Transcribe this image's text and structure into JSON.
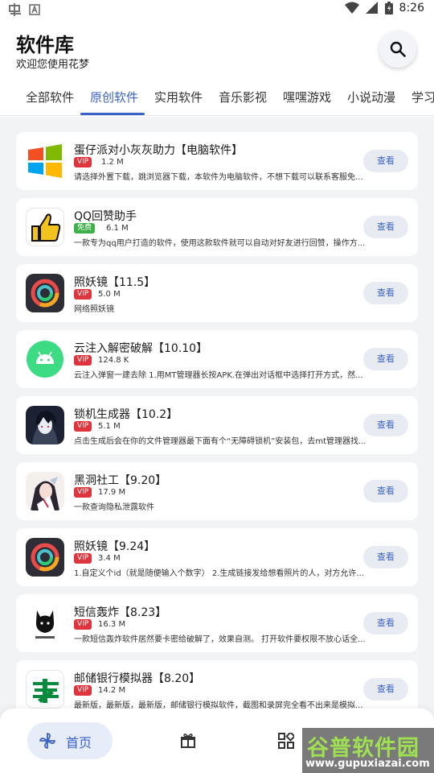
{
  "status_bar": {
    "time": "8:26"
  },
  "header": {
    "title": "软件库",
    "subtitle": "欢迎您使用花梦"
  },
  "tabs": [
    "全部软件",
    "原创软件",
    "实用软件",
    "音乐影视",
    "嘿嘿游戏",
    "小说动漫",
    "学习"
  ],
  "active_tab": "原创软件",
  "apps": [
    {
      "title": "蛋仔派对小灰灰助力【电脑软件】",
      "badge": "VIP",
      "size": "1.2 M",
      "description": "请选择外置下载，跳浏览器下载，本软件为电脑软件，不想下载可以联系客服免...",
      "button": "查看",
      "icon": "windows-logo-icon"
    },
    {
      "title": "QQ回赞助手",
      "badge": "免费",
      "size": "6.1 M",
      "description": "一款专为qq用户打造的软件，使用这款软件就可以自动对好友进行回赞，操作方...",
      "button": "查看",
      "icon": "thumbs-up-icon"
    },
    {
      "title": "照妖镜【11.5】",
      "badge": "VIP",
      "size": "5.0 M",
      "description": "网络照妖镜",
      "button": "查看",
      "icon": "ring-logo-icon"
    },
    {
      "title": "云注入解密破解【10.10】",
      "badge": "VIP",
      "size": "124.8 K",
      "description": "云注入弹窗一建去除 1.用MT管理器长按APK.在弹出对话框中选择打开方式，然...",
      "button": "查看",
      "icon": "android-icon"
    },
    {
      "title": "锁机生成器【10.2】",
      "badge": "VIP",
      "size": "5.1 M",
      "description": "点击生成后会在你的文件管理器最下面有个“无障碍锁机”安装包，去mt管理器找...",
      "button": "查看",
      "icon": "anime-avatar-icon"
    },
    {
      "title": "黑洞社工【9.20】",
      "badge": "VIP",
      "size": "17.9 M",
      "description": "一款查询隐私泄露软件",
      "button": "查看",
      "icon": "anime-girl-icon"
    },
    {
      "title": "照妖镜【9.24】",
      "badge": "VIP",
      "size": "3.4 M",
      "description": "1.自定义个id（就是随便输入个数字） 2.生成链接发给想看照片的人，对方允许...",
      "button": "查看",
      "icon": "ring-logo-icon"
    },
    {
      "title": "短信轰炸【8.23】",
      "badge": "VIP",
      "size": "16.3 M",
      "description": "一款短信轰炸软件居然要卡密给破解了，效果自测。 打开软件要权限不放心话全...",
      "button": "查看",
      "icon": "cat-logo-icon"
    },
    {
      "title": "邮储银行模拟器【8.20】",
      "badge": "VIP",
      "size": "14.2 M",
      "description": "最新版，最新版，最新版，邮储银行模拟软件，截图和录屏完全看不出来是模拟...",
      "button": "查看",
      "icon": "postal-bank-icon"
    }
  ],
  "bottom_nav": {
    "home_label": "首页"
  },
  "watermark": {
    "line1": "谷普软件园",
    "line2": "www.gupuxiazai.com"
  },
  "colors": {
    "accent": "#3a62c8",
    "vip": "#e0343c",
    "free": "#3eb04a"
  }
}
